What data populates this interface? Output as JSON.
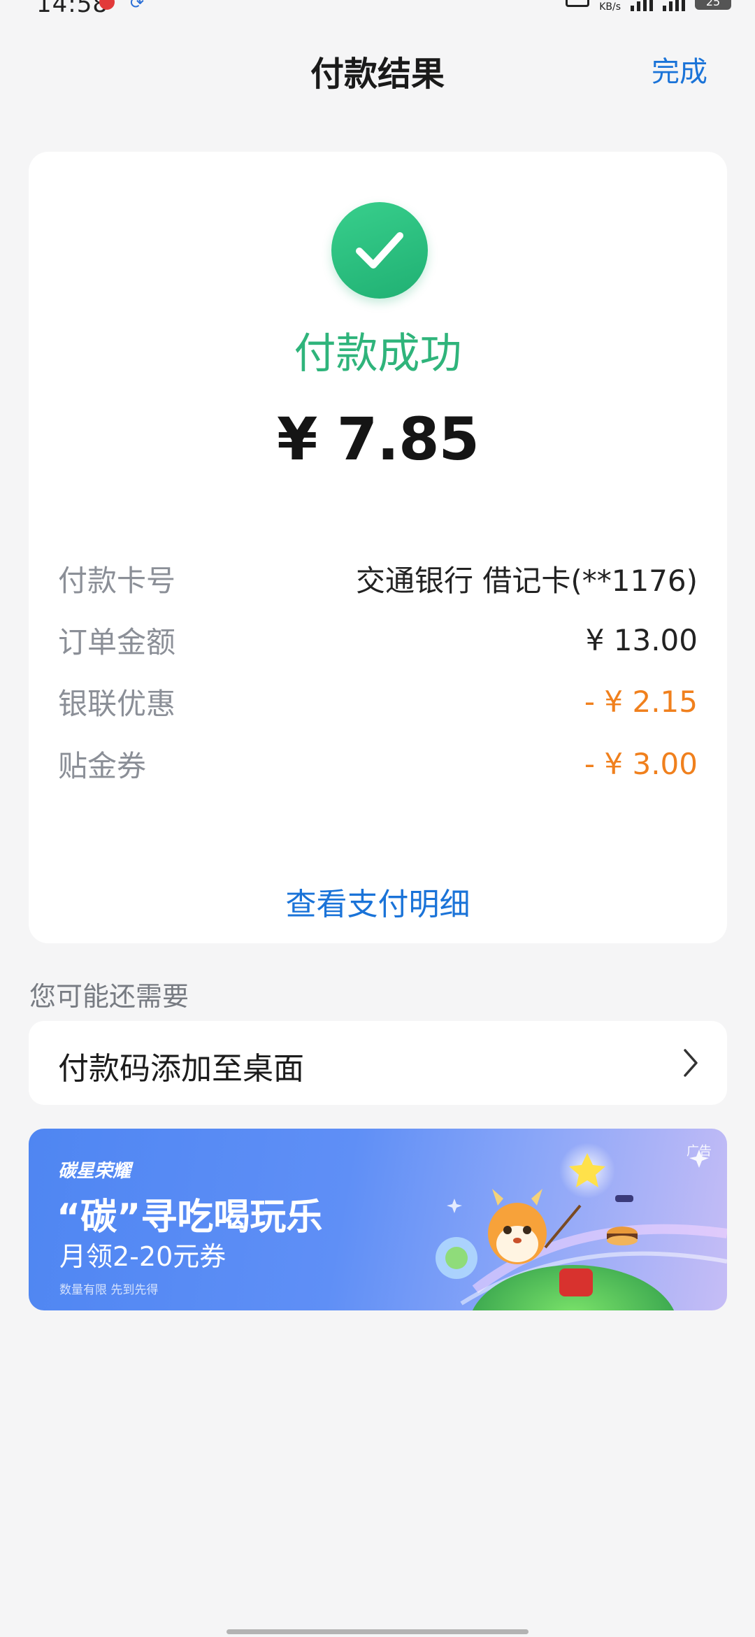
{
  "status_bar": {
    "time": "14:58",
    "speed": "KB/s",
    "battery": "25"
  },
  "nav": {
    "title": "付款结果",
    "done_label": "完成"
  },
  "result": {
    "status_text": "付款成功",
    "amount": "¥ 7.85",
    "details": [
      {
        "label": "付款卡号",
        "value": "交通银行  借记卡(**1176)"
      },
      {
        "label": "订单金额",
        "value": "¥ 13.00"
      },
      {
        "label": "银联优惠",
        "value": "- ¥ 2.15"
      },
      {
        "label": "贴金券",
        "value": "- ¥ 3.00"
      }
    ],
    "view_details_label": "查看支付明细"
  },
  "recommend": {
    "section_title": "您可能还需要",
    "shortcut_label": "付款码添加至桌面"
  },
  "ad": {
    "tag": "广告",
    "brand": "碳星荣耀",
    "headline": "“碳”寻吃喝玩乐",
    "sub": "月领2-20元券",
    "note": "数量有限 先到先得"
  },
  "colors": {
    "success": "#2fb47b",
    "link": "#1a73d8",
    "discount": "#f0801d"
  }
}
